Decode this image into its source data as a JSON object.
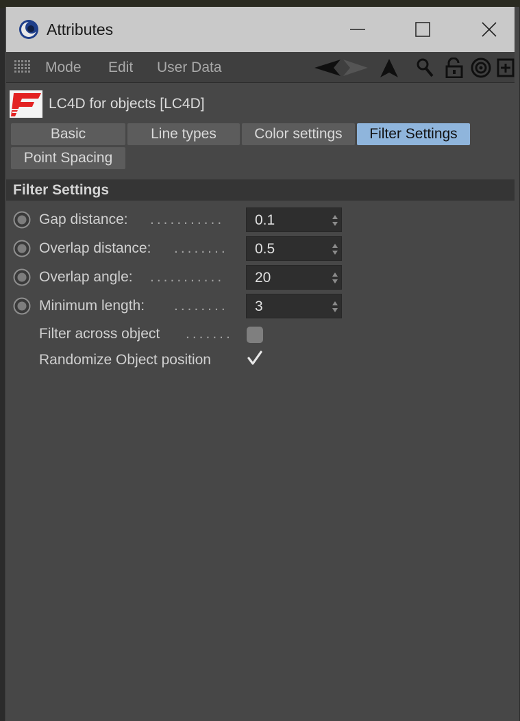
{
  "window": {
    "title": "Attributes"
  },
  "menu": {
    "items": [
      "Mode",
      "Edit",
      "User Data"
    ]
  },
  "toolbar_icons": [
    "back-arrow-icon",
    "forward-arrow-icon",
    "up-arrow-icon",
    "search-icon",
    "unlock-icon",
    "target-icon",
    "new-panel-icon"
  ],
  "object": {
    "name": "LC4D for objects [LC4D]",
    "icon": "lc4d-logo-icon"
  },
  "tabs": [
    {
      "label": "Basic",
      "active": false
    },
    {
      "label": "Line types",
      "active": false
    },
    {
      "label": "Color settings",
      "active": false
    },
    {
      "label": "Filter Settings",
      "active": true
    },
    {
      "label": "Point Spacing",
      "active": false
    }
  ],
  "section": {
    "title": "Filter Settings"
  },
  "params": [
    {
      "label": "Gap distance:",
      "dots": "...........",
      "value": "0.1"
    },
    {
      "label": "Overlap distance:",
      "dots": "........",
      "value": "0.5"
    },
    {
      "label": "Overlap angle:",
      "dots": "...........",
      "value": "20"
    },
    {
      "label": "Minimum length:",
      "dots": "........",
      "value": "3"
    }
  ],
  "checks": [
    {
      "label": "Filter across object",
      "dots": ".......",
      "checked": false
    },
    {
      "label": "Randomize Object position",
      "dots": "",
      "checked": true
    }
  ],
  "colors": {
    "active_tab": "#8fb5dc",
    "panel_bg": "#474747",
    "titlebar": "#c9c9c9"
  }
}
